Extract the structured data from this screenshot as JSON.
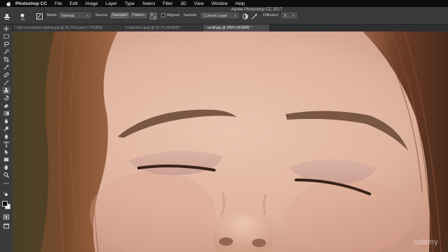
{
  "menubar": {
    "app_name": "Photoshop CC",
    "items": [
      "File",
      "Edit",
      "Image",
      "Layer",
      "Type",
      "Select",
      "Filter",
      "3D",
      "View",
      "Window",
      "Help"
    ]
  },
  "window": {
    "title": "Adobe Photoshop CC 2017"
  },
  "options": {
    "brush_size": "40",
    "mode_label": "Mode:",
    "mode_value": "Normal",
    "source_label": "Source:",
    "sampled_label": "Sampled",
    "pattern_label": "Pattern",
    "aligned_label": "Aligned",
    "sample_label": "Sample:",
    "sample_value": "Current Layer",
    "diffusion_label": "Diffusion:",
    "diffusion_value": "5"
  },
  "tabs": [
    {
      "label": "city-man-person-skyline.jpg @ 66.7% (Layer 0, RGB/8) *",
      "active": false
    },
    {
      "label": "hatsclone.jpeg @ 66.7% (RGB/8) *",
      "active": false
    },
    {
      "label": "sect8.jpg @ 200% (RGB/8) *",
      "active": true
    }
  ],
  "tools": [
    "move-icon",
    "marquee-icon",
    "lasso-icon",
    "quick-select-icon",
    "crop-icon",
    "eyedropper-icon",
    "healing-brush-icon",
    "brush-icon",
    "clone-stamp-icon",
    "history-brush-icon",
    "eraser-icon",
    "gradient-icon",
    "blur-icon",
    "dodge-icon",
    "pen-icon",
    "type-icon",
    "path-select-icon",
    "shape-icon",
    "hand-icon",
    "zoom-icon",
    "more-tools-icon"
  ],
  "canvas": {
    "watermark": "udemy",
    "skin_color": "#e2b9a4",
    "hair_color": "#6b3a26",
    "brow_color": "#6e4a3a"
  }
}
